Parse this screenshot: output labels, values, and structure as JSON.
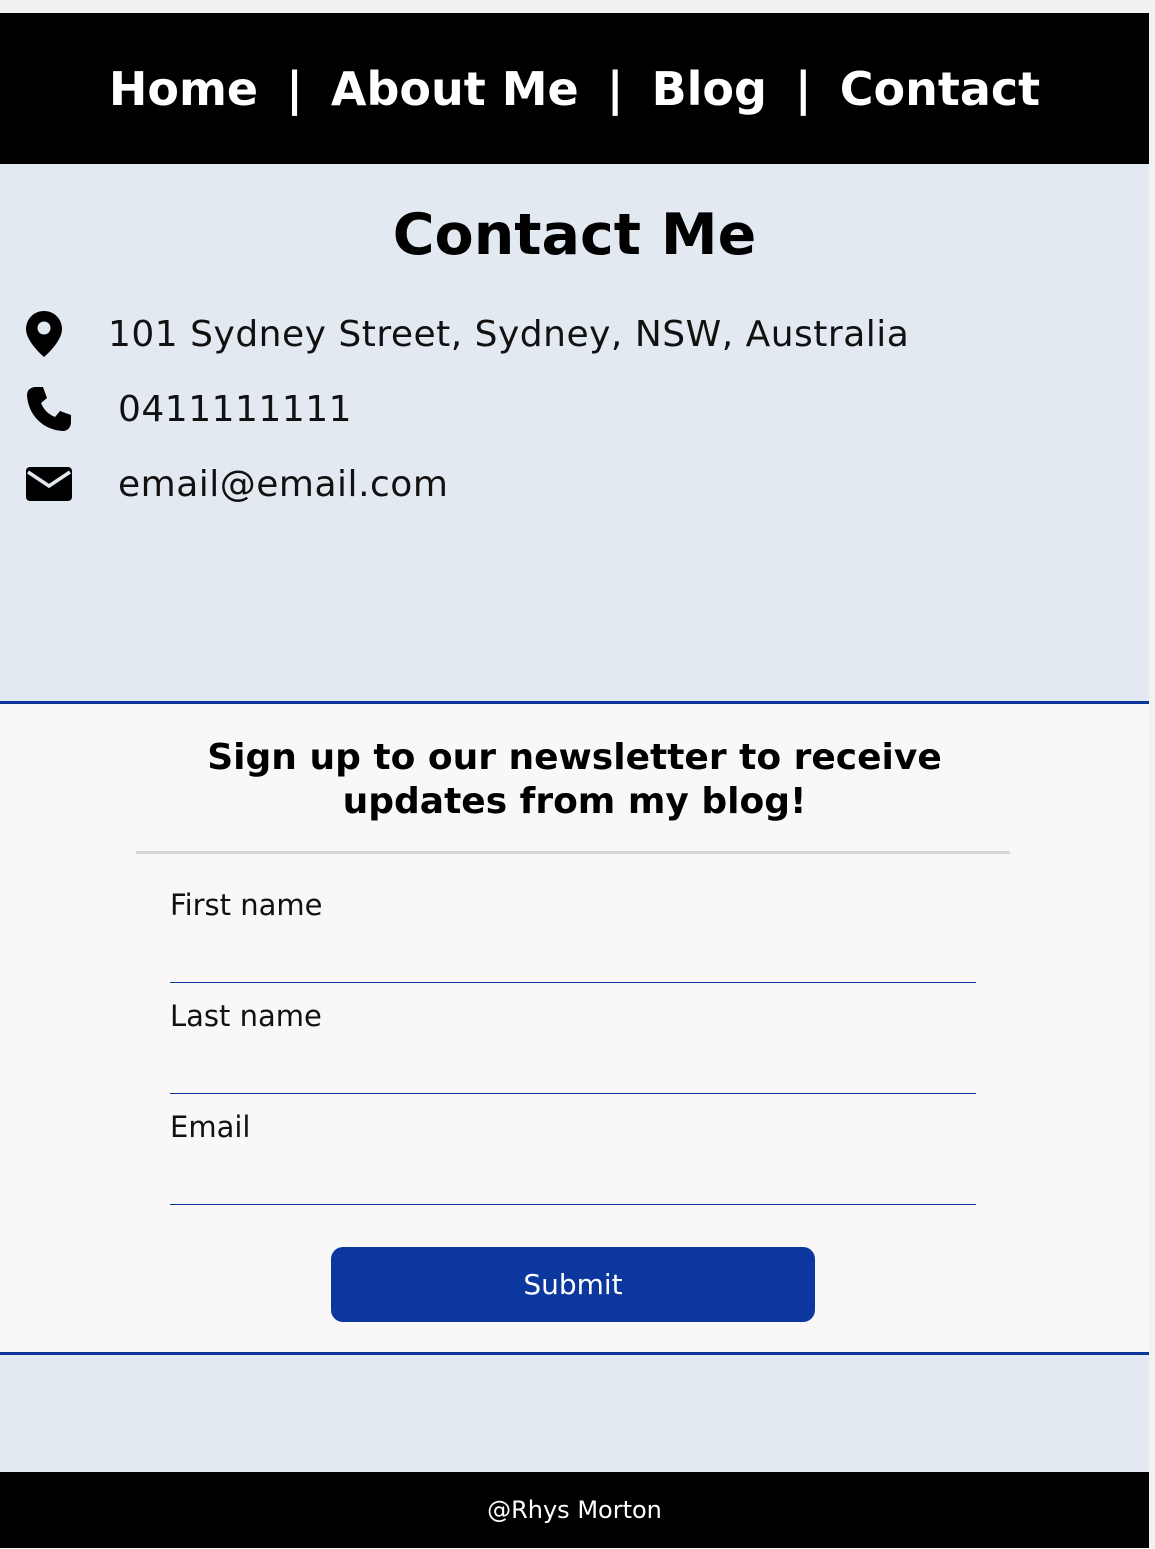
{
  "nav": {
    "items": [
      "Home",
      "About Me",
      "Blog",
      "Contact"
    ],
    "separator": "|"
  },
  "contact": {
    "title": "Contact Me",
    "address": "101 Sydney Street, Sydney, NSW, Australia",
    "phone": "0411111111",
    "email": "email@email.com",
    "icons": [
      "map-pin-icon",
      "phone-icon",
      "envelope-icon"
    ]
  },
  "newsletter": {
    "heading_line1": "Sign up to our newsletter to receive",
    "heading_line2": "updates from my blog!",
    "first_name_label": "First name",
    "last_name_label": "Last name",
    "email_label": "Email",
    "submit_label": "Submit"
  },
  "footer": {
    "text": "@Rhys Morton"
  },
  "colors": {
    "nav_bg": "#000000",
    "section_bg": "#e3e9f0",
    "form_bg": "#f9f8f6",
    "accent": "#0b379f"
  }
}
